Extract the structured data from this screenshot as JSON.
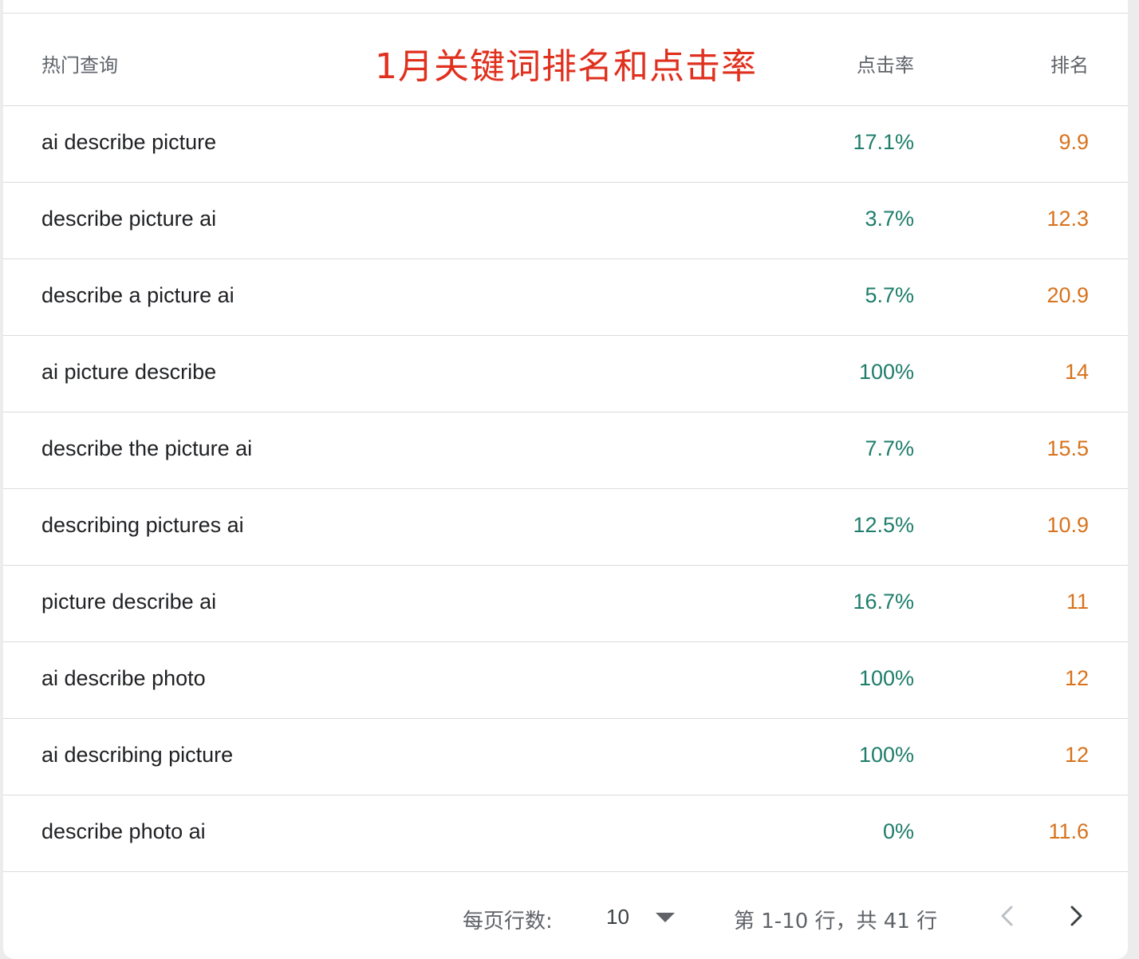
{
  "header": {
    "query_col": "热门查询",
    "annotation": "1月关键词排名和点击率",
    "ctr_col": "点击率",
    "rank_col": "排名"
  },
  "rows": [
    {
      "query": "ai describe picture",
      "ctr": "17.1%",
      "rank": "9.9"
    },
    {
      "query": "describe picture ai",
      "ctr": "3.7%",
      "rank": "12.3"
    },
    {
      "query": "describe a picture ai",
      "ctr": "5.7%",
      "rank": "20.9"
    },
    {
      "query": "ai picture describe",
      "ctr": "100%",
      "rank": "14"
    },
    {
      "query": "describe the picture ai",
      "ctr": "7.7%",
      "rank": "15.5"
    },
    {
      "query": "describing pictures ai",
      "ctr": "12.5%",
      "rank": "10.9"
    },
    {
      "query": "picture describe ai",
      "ctr": "16.7%",
      "rank": "11"
    },
    {
      "query": "ai describe photo",
      "ctr": "100%",
      "rank": "12"
    },
    {
      "query": "ai describing picture",
      "ctr": "100%",
      "rank": "12"
    },
    {
      "query": "describe photo ai",
      "ctr": "0%",
      "rank": "11.6"
    }
  ],
  "pagination": {
    "rows_per_page_label": "每页行数:",
    "rows_per_page_value": "10",
    "range_label": "第 1-10 行，共 41 行",
    "prev_icon": "chevron-left-icon",
    "next_icon": "chevron-right-icon"
  },
  "colors": {
    "ctr": "#1e7d6b",
    "rank": "#d8721c",
    "annotation": "#e0301e"
  }
}
